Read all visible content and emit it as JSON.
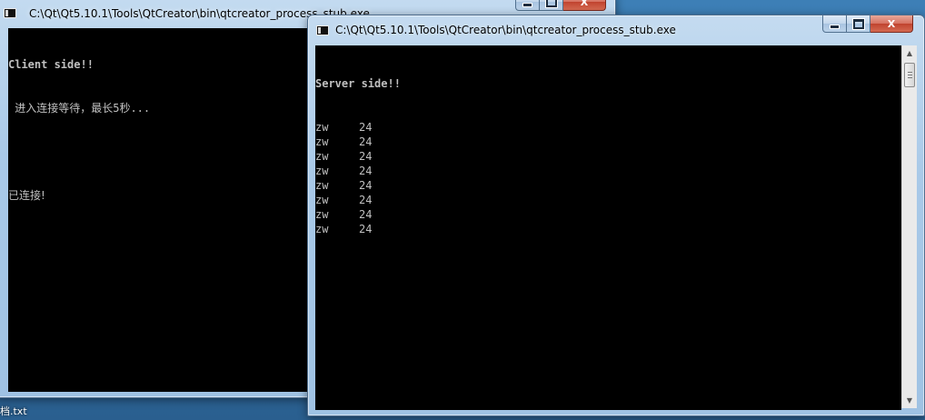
{
  "client_window": {
    "title": "C:\\Qt\\Qt5.10.1\\Tools\\QtCreator\\bin\\qtcreator_process_stub.exe",
    "lines": [
      "Client side!!",
      " 进入连接等待，最长5秒...",
      "",
      "已连接!"
    ]
  },
  "server_window": {
    "title": "C:\\Qt\\Qt5.10.1\\Tools\\QtCreator\\bin\\qtcreator_process_stub.exe",
    "header": "Server side!!",
    "rows": [
      {
        "name": "zw",
        "value": "24"
      },
      {
        "name": "zw",
        "value": "24"
      },
      {
        "name": "zw",
        "value": "24"
      },
      {
        "name": "zw",
        "value": "24"
      },
      {
        "name": "zw",
        "value": "24"
      },
      {
        "name": "zw",
        "value": "24"
      },
      {
        "name": "zw",
        "value": "24"
      },
      {
        "name": "zw",
        "value": "24"
      }
    ]
  },
  "controls": {
    "minimize_icon": "minimize-icon",
    "maximize_icon": "maximize-icon",
    "close_glyph": "X"
  },
  "desktop": {
    "file_label": "档.txt"
  }
}
